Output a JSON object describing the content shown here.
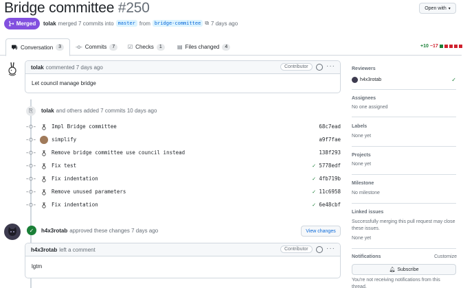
{
  "header": {
    "title": "Bridge committee",
    "number": "#250",
    "open_with": "Open with",
    "state": "Merged",
    "author": "tolak",
    "merged_text": "merged 7 commits into",
    "base_branch": "master",
    "from_text": "from",
    "head_branch": "bridge-committee",
    "time": "7 days ago"
  },
  "tabs": [
    {
      "label": "Conversation",
      "count": "3",
      "icon": "conversation-icon"
    },
    {
      "label": "Commits",
      "count": "7",
      "icon": "commit-icon"
    },
    {
      "label": "Checks",
      "count": "1",
      "icon": "checks-icon"
    },
    {
      "label": "Files changed",
      "count": "4",
      "icon": "file-diff-icon"
    }
  ],
  "diffstat": {
    "additions": "+10",
    "deletions": "−17",
    "colors": [
      "#1a7f37",
      "#cf222e",
      "#cf222e",
      "#cf222e",
      "#cf222e"
    ]
  },
  "first_comment": {
    "author": "tolak",
    "action": "commented 7 days ago",
    "role": "Contributor",
    "body": "Let council manage bridge"
  },
  "commits_event": {
    "author": "tolak",
    "text": "and others added 7 commits 10 days ago"
  },
  "commits": [
    {
      "message": "Impl Bridge committee",
      "sha": "68c7ead",
      "status": ""
    },
    {
      "message": "simplify",
      "sha": "a9f7fae",
      "status": ""
    },
    {
      "message": "Remove bridge committee use council instead",
      "sha": "138f293",
      "status": ""
    },
    {
      "message": "Fix test",
      "sha": "5778edf",
      "status": "success"
    },
    {
      "message": "Fix indentation",
      "sha": "4fb719b",
      "status": "success"
    },
    {
      "message": "Remove unused parameters",
      "sha": "11c6958",
      "status": "success"
    },
    {
      "message": "Fix indentation",
      "sha": "6e48cbf",
      "status": "success"
    }
  ],
  "review": {
    "author": "h4x3rotab",
    "text": "approved these changes 7 days ago",
    "view_changes": "View changes"
  },
  "second_comment": {
    "author": "h4x3rotab",
    "action": "left a comment",
    "role": "Contributor",
    "body": "lgtm"
  },
  "sidebar": {
    "reviewers_label": "Reviewers",
    "reviewer": "h4x3rotab",
    "assignees_label": "Assignees",
    "assignees_value": "No one assigned",
    "labels_label": "Labels",
    "labels_value": "None yet",
    "projects_label": "Projects",
    "projects_value": "None yet",
    "milestone_label": "Milestone",
    "milestone_value": "No milestone",
    "linked_label": "Linked issues",
    "linked_text": "Successfully merging this pull request may close these issues.",
    "linked_value": "None yet",
    "notifications_label": "Notifications",
    "customize": "Customize",
    "subscribe": "Subscribe",
    "notify_text": "You're not receiving notifications from this thread."
  }
}
